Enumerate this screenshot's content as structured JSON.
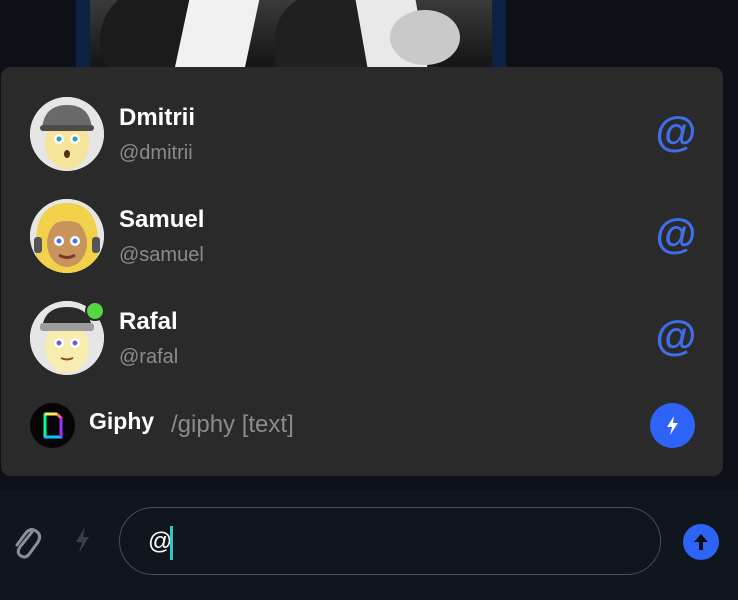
{
  "suggestions": [
    {
      "name": "Dmitrii",
      "handle": "@dmitrii",
      "online": false,
      "action_icon": "at-icon"
    },
    {
      "name": "Samuel",
      "handle": "@samuel",
      "online": false,
      "action_icon": "at-icon"
    },
    {
      "name": "Rafal",
      "handle": "@rafal",
      "online": true,
      "action_icon": "at-icon"
    }
  ],
  "command": {
    "name": "Giphy",
    "hint": "/giphy [text]",
    "action_icon": "bolt-icon"
  },
  "composer": {
    "value": "@",
    "attach_icon": "paperclip-icon",
    "commands_icon": "bolt-icon",
    "send_icon": "arrow-up-icon"
  },
  "colors": {
    "accent": "#2d63f6",
    "mention": "#3f6ee8",
    "online": "#56d742",
    "popup_bg": "#2a2a2b",
    "caret": "#33c4c4"
  }
}
